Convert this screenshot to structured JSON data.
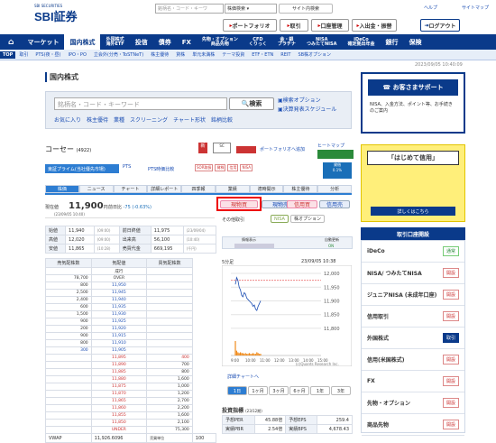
{
  "header": {
    "logo": "SBI証券",
    "logo_sub": "SBI SECURITIES",
    "search_placeholder": "銘柄名・コード・キーワ",
    "search_scope": "株価検索",
    "site_search": "サイト内検索",
    "help": "ヘルプ",
    "sitemap": "サイトマップ",
    "portfolio": "ポートフォリオ",
    "trade": "取引",
    "account": "口座管理",
    "deposit": "入出金・振替",
    "logout": "ログアウト"
  },
  "nav": {
    "items": [
      {
        "label": "マーケット"
      },
      {
        "label": "国内株式"
      },
      {
        "label": "外国株式",
        "sub": "海外ETF"
      },
      {
        "label": "投信"
      },
      {
        "label": "債券"
      },
      {
        "label": "FX"
      },
      {
        "label": "先物・オプション",
        "sub": "商品先物"
      },
      {
        "label": "CFD",
        "sub": "くりっく"
      },
      {
        "label": "金・銀",
        "sub": "プラチナ"
      },
      {
        "label": "NISA",
        "sub": "つみたてNISA"
      },
      {
        "label": "iDeCo",
        "sub": "確定拠出年金"
      },
      {
        "label": "銀行"
      },
      {
        "label": "保険"
      }
    ],
    "sub": [
      "TOP",
      "取引",
      "PTS(夜・昼)",
      "IPO・PO",
      "立会外(分売・ToSTNeT)",
      "株主優待",
      "貸株",
      "単元未満株",
      "テーマ投資",
      "ETF・ETN",
      "REIT",
      "SB株オプション"
    ]
  },
  "date": "2023/09/05 10:40:09",
  "page_title": "国内株式",
  "search": {
    "placeholder": "銘柄名・コード・キーワード",
    "button": "検索",
    "links": [
      "お気に入り",
      "株主優待",
      "業種",
      "スクリーニング",
      "チャート形状",
      "銘柄比較"
    ],
    "r1": "検索オプション",
    "r2": "決算発表スケジュール"
  },
  "stock": {
    "name": "コーセー",
    "code": "(4922)",
    "market": "東証プライム(当社優先市場)",
    "pts": "PTS",
    "pts_link": "PTS時価比較",
    "tags": [
      "SOR取扱",
      "貸株",
      "信用",
      "NISA"
    ],
    "chart_link": "ポートフォリオへ追加",
    "heatmap": "ヒートマップ"
  },
  "tabs": [
    "株価",
    "ニュース",
    "チャート",
    "詳細レポート",
    "四季報",
    "業績",
    "適時開示",
    "株主優待",
    "分析"
  ],
  "price": {
    "label": "現在値",
    "value": "11,900",
    "unit": "円",
    "time": "(23/09/05 10:40)",
    "prev_label": "前日比",
    "change": "-75 (-0.63%)"
  },
  "order": {
    "cash_buy": "現物買",
    "cash_sell": "現物売",
    "margin_buy": "信用買",
    "margin_sell": "信用売",
    "other": "その他取引",
    "nisa": "NISA",
    "bond": "株オプション"
  },
  "quote": [
    [
      "始値",
      "11,940",
      "(09:00)",
      "前日終値",
      "11,975",
      "(23/09/04)"
    ],
    [
      "高値",
      "12,020",
      "(09:00)",
      "出来高",
      "56,100",
      "(10:40)"
    ],
    [
      "安値",
      "11,865",
      "(10:28)",
      "売買代金",
      "669,195",
      "(千円)"
    ]
  ],
  "book": {
    "headers": [
      "売気配株数",
      "気配値",
      "買気配株数"
    ],
    "rows": [
      [
        "",
        "成行",
        ""
      ],
      [
        "78,700",
        "OVER",
        ""
      ],
      [
        "800",
        "11,950",
        ""
      ],
      [
        "2,500",
        "11,945",
        ""
      ],
      [
        "2,400",
        "11,940",
        ""
      ],
      [
        "600",
        "11,935",
        ""
      ],
      [
        "1,500",
        "11,930",
        ""
      ],
      [
        "900",
        "11,925",
        ""
      ],
      [
        "200",
        "11,920",
        ""
      ],
      [
        "900",
        "11,915",
        ""
      ],
      [
        "800",
        "11,910",
        ""
      ],
      [
        "300",
        "11,905",
        ""
      ],
      [
        "",
        "11,895",
        "400"
      ],
      [
        "",
        "11,890",
        "700"
      ],
      [
        "",
        "11,885",
        "800"
      ],
      [
        "",
        "11,880",
        "1,600"
      ],
      [
        "",
        "11,875",
        "1,000"
      ],
      [
        "",
        "11,870",
        "1,200"
      ],
      [
        "",
        "11,865",
        "2,700"
      ],
      [
        "",
        "11,860",
        "2,200"
      ],
      [
        "",
        "11,855",
        "1,600"
      ],
      [
        "",
        "11,850",
        "2,100"
      ],
      [
        "",
        "UNDER",
        "75,300"
      ]
    ],
    "vwap_label": "VWAP",
    "vwap": "11,926.6096",
    "vol_label": "売買単位",
    "vol": "100"
  },
  "chart": {
    "interval_label": "5分足",
    "date": "23/09/05 10:38",
    "credit": "(c)Quants Research Inc.",
    "link": "詳細チャートへ",
    "ranges": [
      "1日",
      "1ヶ月",
      "3ヶ月",
      "6ヶ月",
      "1年",
      "3年"
    ],
    "yticks": [
      "12,000",
      "11,950",
      "11,900",
      "11,850",
      "11,800"
    ],
    "xticks": [
      "9:00",
      "10:00",
      "11:00",
      "12:00",
      "13:00",
      "14:00",
      "15:00"
    ],
    "display_label": "情報表示",
    "auto_label": "自動更新",
    "auto_value": "ON"
  },
  "metrics": {
    "title": "投資指標",
    "sub": "(23/12期)",
    "rows": [
      [
        "予想PER",
        "45.88倍",
        "予想EPS",
        "259.4"
      ],
      [
        "実績PBR",
        "2.54倍",
        "実績BPS",
        "4,678.43"
      ]
    ]
  },
  "right": {
    "support": "お客さまサポート",
    "support_sub": "NISA、入金方法、ポイント等、お手続きのご案内",
    "banner_title": "「はじめて信用」",
    "banner_link": "詳しくはこちら",
    "trade_head": "取引口座開設",
    "items": [
      {
        "label": "iDeCo",
        "badge": "通常"
      },
      {
        "label": "NISA/ つみたてNISA",
        "badge": "開設"
      },
      {
        "label": "ジュニアNISA (未成年口座)",
        "badge": "開設"
      },
      {
        "label": "信用取引",
        "badge": "開設"
      },
      {
        "label": "外国株式",
        "badge": "取引"
      },
      {
        "label": "信用(米国株式)",
        "badge": "開設"
      },
      {
        "label": "FX",
        "badge": "開設"
      },
      {
        "label": "先物・オプション",
        "badge": "開設"
      },
      {
        "label": "商品先物",
        "badge": "開設"
      }
    ]
  },
  "chart_data": {
    "type": "line",
    "title": "5分足",
    "x": [
      "9:00",
      "9:05",
      "9:10",
      "9:15",
      "9:20",
      "9:25",
      "9:30",
      "9:35",
      "9:40",
      "9:45",
      "9:50",
      "9:55",
      "10:00",
      "10:05",
      "10:10",
      "10:15",
      "10:20",
      "10:25",
      "10:30",
      "10:35",
      "10:38"
    ],
    "values": [
      11960,
      11985,
      11975,
      11950,
      11940,
      11920,
      11915,
      11930,
      11925,
      11910,
      11905,
      11900,
      11895,
      11890,
      11880,
      11885,
      11870,
      11865,
      11880,
      11890,
      11900
    ],
    "ylim": [
      11780,
      12010
    ],
    "volume": [
      18,
      6,
      4,
      3,
      4,
      3,
      3,
      2,
      3,
      2,
      2,
      3,
      2,
      2,
      3,
      2,
      2,
      4,
      3,
      2,
      2
    ]
  }
}
